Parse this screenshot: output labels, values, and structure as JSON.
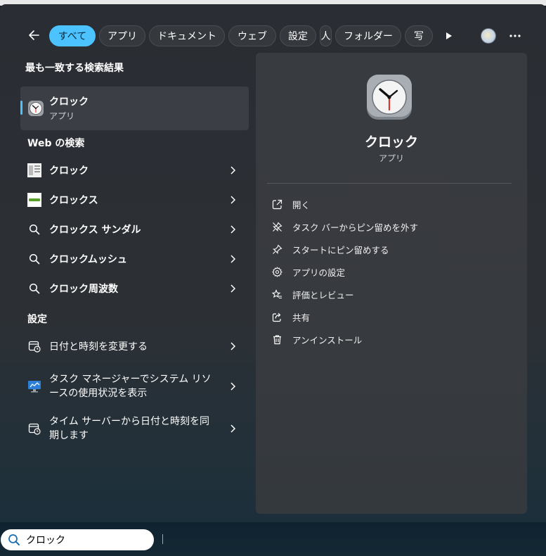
{
  "filter_bar": {
    "chips": [
      "すべて",
      "アプリ",
      "ドキュメント",
      "ウェブ",
      "設定",
      "人",
      "フォルダー",
      "写"
    ]
  },
  "left": {
    "best_match_title": "最も一致する検索結果",
    "best_match": {
      "name": "クロック",
      "kind": "アプリ"
    },
    "web_title": "Web の検索",
    "web_items": [
      {
        "pre": "クロック",
        "bold": ""
      },
      {
        "pre": "クロック",
        "bold": "ス"
      },
      {
        "pre": "クロック",
        "bold": "ス サンダル"
      },
      {
        "pre": "クロック",
        "bold": "ムッシュ"
      },
      {
        "pre": "クロック",
        "bold": "周波数"
      }
    ],
    "settings_title": "設定",
    "settings_items": [
      "日付と時刻を変更する",
      "タスク マネージャーでシステム リソースの使用状況を表示",
      "タイム サーバーから日付と時刻を同期します"
    ]
  },
  "detail": {
    "name": "クロック",
    "kind": "アプリ",
    "actions": [
      "開く",
      "タスク バーからピン留めを外す",
      "スタートにピン留めする",
      "アプリの設定",
      "評価とレビュー",
      "共有",
      "アンインストール"
    ]
  },
  "search": {
    "value": "クロック"
  },
  "colors": {
    "accent": "#4cc2ff"
  }
}
